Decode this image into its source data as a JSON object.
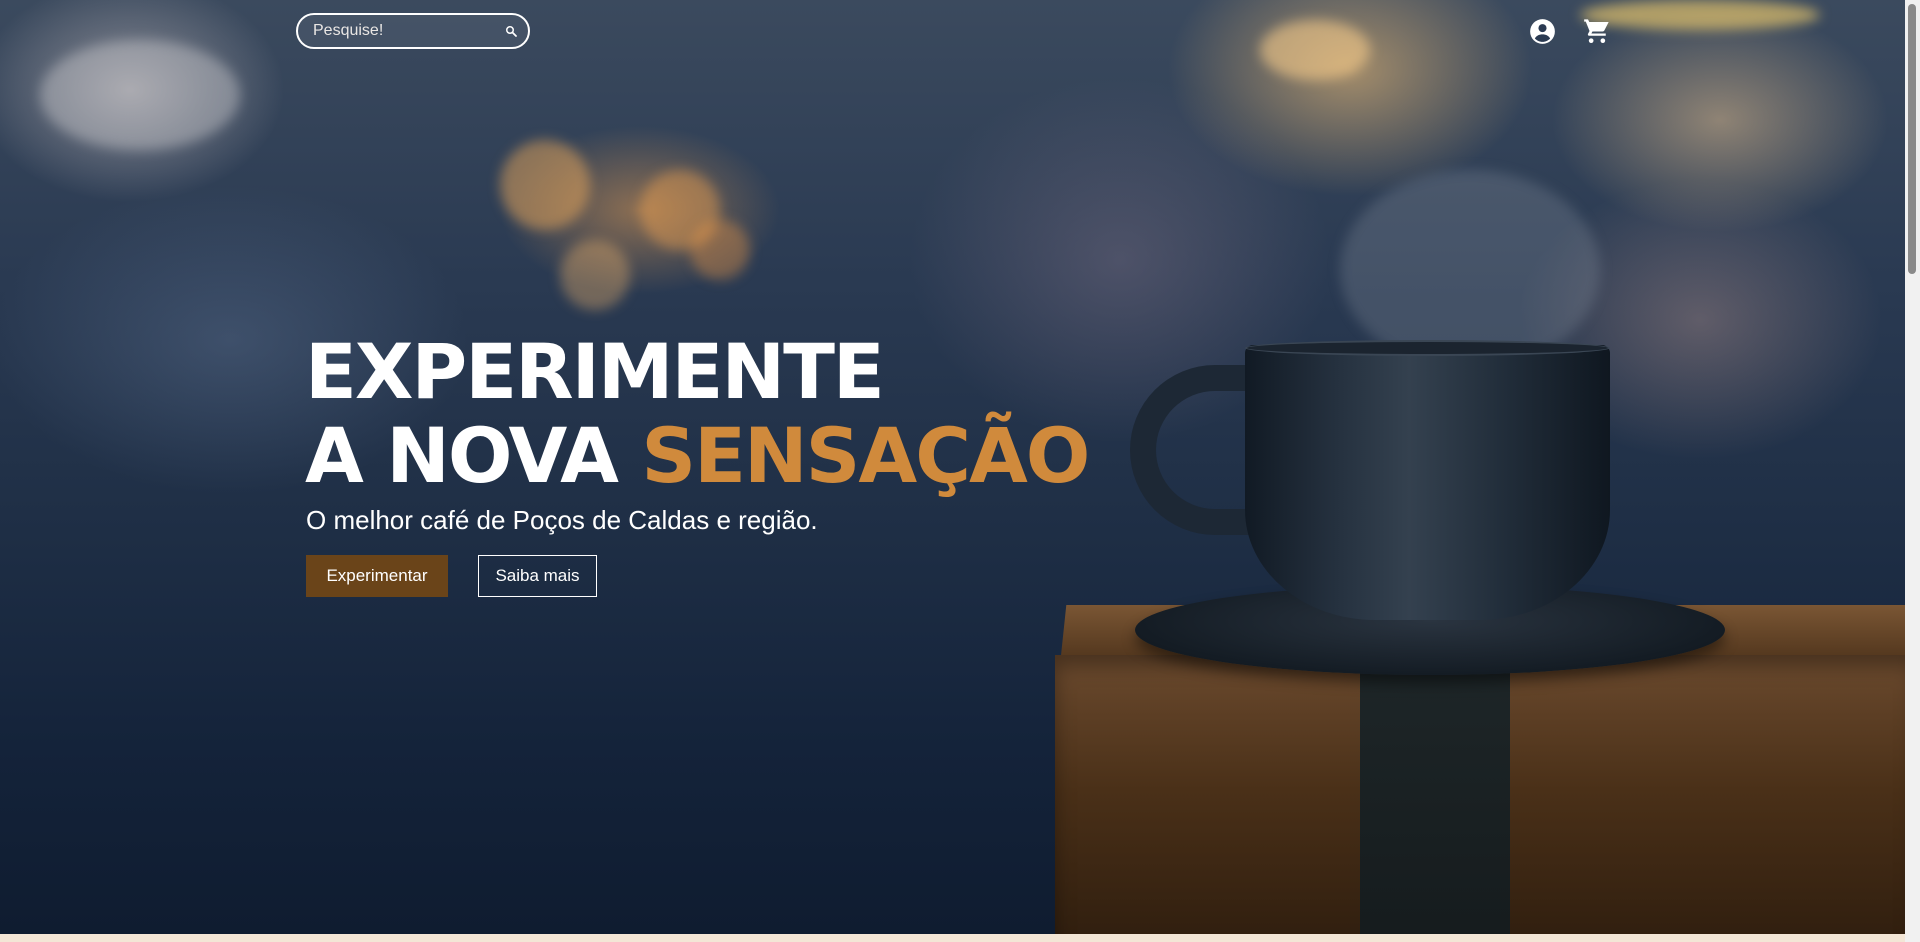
{
  "search": {
    "placeholder": "Pesquise!"
  },
  "header": {
    "icons": [
      "account-icon",
      "cart-icon"
    ]
  },
  "hero": {
    "headline_line1": "EXPERIMENTE",
    "headline_line2_prefix": "A NOVA ",
    "headline_line2_accent": "SENSAÇÃO",
    "subtitle": "O melhor café de Poços de Caldas e região.",
    "primary_button": "Experimentar",
    "secondary_button": "Saiba mais"
  },
  "colors": {
    "accent": "#d08a3c",
    "primary_button": "#6a4419",
    "text": "#ffffff"
  }
}
